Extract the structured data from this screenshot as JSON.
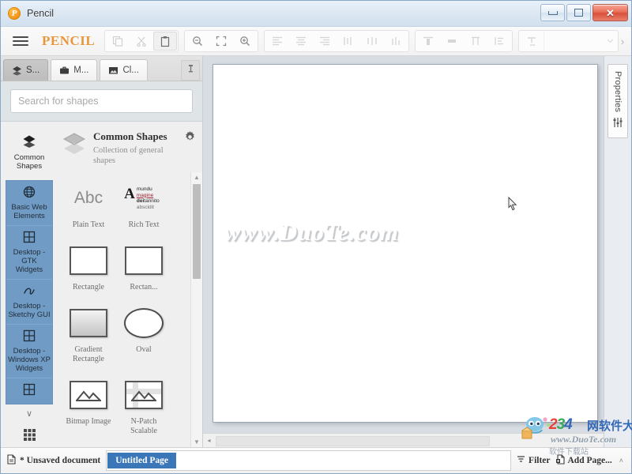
{
  "window": {
    "title": "Pencil",
    "app_icon": "pencil-app-icon",
    "controls": {
      "minimize": "minimize",
      "maximize": "maximize",
      "close": "close"
    }
  },
  "toolbar": {
    "menu_label": "menu",
    "brand": "PENCIL",
    "groups": [
      {
        "name": "clipboard",
        "buttons": [
          {
            "name": "copy-button",
            "icon": "copy-icon",
            "enabled": false
          },
          {
            "name": "cut-button",
            "icon": "scissors-icon",
            "enabled": false
          },
          {
            "name": "paste-button",
            "icon": "clipboard-icon",
            "enabled": true
          }
        ]
      },
      {
        "name": "zoom",
        "buttons": [
          {
            "name": "zoom-out-button",
            "icon": "zoom-out-icon",
            "enabled": true
          },
          {
            "name": "zoom-fit-button",
            "icon": "fit-screen-icon",
            "enabled": true
          },
          {
            "name": "zoom-in-button",
            "icon": "zoom-in-icon",
            "enabled": true
          }
        ]
      },
      {
        "name": "align",
        "buttons": [
          {
            "name": "align-left-button",
            "icon": "align-left-icon",
            "enabled": false
          },
          {
            "name": "align-center-button",
            "icon": "align-center-icon",
            "enabled": false
          },
          {
            "name": "align-right-button",
            "icon": "align-right-icon",
            "enabled": false
          },
          {
            "name": "distribute-left-button",
            "icon": "distribute-left-icon",
            "enabled": false
          },
          {
            "name": "distribute-center-button",
            "icon": "distribute-center-icon",
            "enabled": false
          },
          {
            "name": "distribute-right-button",
            "icon": "distribute-right-icon",
            "enabled": false
          }
        ]
      },
      {
        "name": "vertical-align",
        "buttons": [
          {
            "name": "align-top-button",
            "icon": "align-top-icon",
            "enabled": false
          },
          {
            "name": "align-middle-button",
            "icon": "align-middle-icon",
            "enabled": false
          },
          {
            "name": "align-bottom-button",
            "icon": "align-bottom-icon",
            "enabled": false
          },
          {
            "name": "distribute-vertical-button",
            "icon": "distribute-vertical-icon",
            "enabled": false
          }
        ]
      }
    ],
    "font_tool": {
      "name": "text-format-button",
      "icon": "text-format-icon",
      "enabled": false
    },
    "font_combo": {
      "name": "font-size-combo",
      "value": "",
      "enabled": false
    },
    "overflow_label": "›"
  },
  "left_panel": {
    "tabs": [
      {
        "id": "shapes",
        "label": "S...",
        "icon": "shapes-icon",
        "selected": true
      },
      {
        "id": "tools",
        "label": "M...",
        "icon": "briefcase-icon",
        "selected": false
      },
      {
        "id": "clipart",
        "label": "Cl...",
        "icon": "image-icon",
        "selected": false
      }
    ],
    "pin_button": {
      "name": "pin-panel-button",
      "icon": "pin-icon"
    },
    "search": {
      "placeholder": "Search for shapes",
      "value": ""
    },
    "rail": {
      "current": {
        "label": "Common Shapes",
        "icon": "layers-icon"
      },
      "items": [
        {
          "label": "Basic Web Elements",
          "icon": "globe-icon"
        },
        {
          "label": "Desktop - GTK Widgets",
          "icon": "grid-icon"
        },
        {
          "label": "Desktop - Sketchy GUI",
          "icon": "sketch-icon"
        },
        {
          "label": "Desktop - Windows XP Widgets",
          "icon": "grid-icon"
        },
        {
          "label": "",
          "icon": "grid-icon"
        }
      ],
      "more_label": "∨",
      "grid_toggle": "all-collections-icon"
    },
    "collection": {
      "title": "Common Shapes",
      "subtitle": "Collection of general shapes",
      "settings_icon": "gear-icon"
    },
    "shapes": [
      {
        "label": "Plain Text",
        "art": "abc"
      },
      {
        "label": "Rich Text",
        "art": "richtext"
      },
      {
        "label": "Rectangle",
        "art": "rect"
      },
      {
        "label": "Rectan...",
        "art": "rect"
      },
      {
        "label": "Gradient Rectangle",
        "art": "gradrect"
      },
      {
        "label": "Oval",
        "art": "oval"
      },
      {
        "label": "Bitmap Image",
        "art": "bitmap"
      },
      {
        "label": "N-Patch Scalable",
        "art": "npatch"
      }
    ]
  },
  "canvas": {
    "watermark": "www.DuoTe.com",
    "scroll_left_label": "◂"
  },
  "properties_panel": {
    "label": "Properties",
    "icon": "sliders-icon"
  },
  "statusbar": {
    "document_icon": "document-icon",
    "document_name": "* Unsaved document",
    "pages": [
      {
        "label": "Untitled Page",
        "active": true
      }
    ],
    "filter": {
      "label": "Filter",
      "icon": "filter-icon"
    },
    "add_page": {
      "label": "Add Page...",
      "icon": "add-page-icon"
    },
    "collapse_label": "˄"
  },
  "site_watermark": {
    "number": "234",
    "number_colors": [
      "#e8392f",
      "#2fa84f",
      "#2a62b5"
    ],
    "chinese": "网软件大全",
    "url": "www.DuoTe.com",
    "tagline": "软件下载站"
  },
  "colors": {
    "brand": "#e8963c",
    "rail_selected": "#6f9bc4",
    "page_tab": "#3a76b8"
  }
}
